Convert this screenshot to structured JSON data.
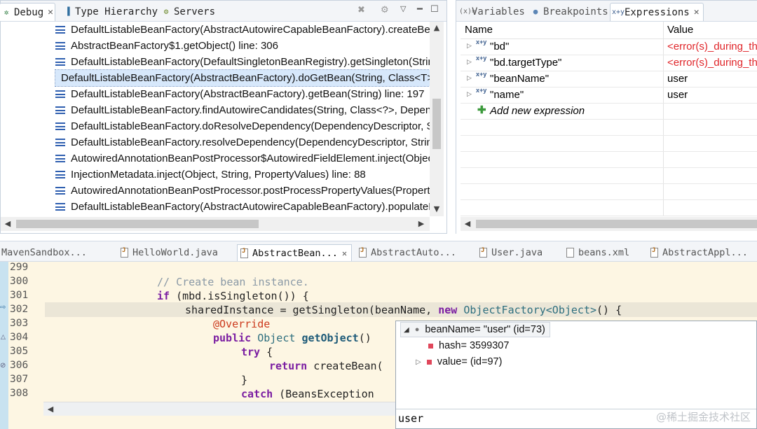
{
  "debug": {
    "tabs": [
      {
        "label": "Debug",
        "icon": "debug-icon"
      },
      {
        "label": "Type Hierarchy",
        "icon": "hierarchy-icon"
      },
      {
        "label": "Servers",
        "icon": "servers-icon"
      }
    ],
    "frames": [
      "DefaultListableBeanFactory(AbstractAutowireCapableBeanFactory).createBea",
      "AbstractBeanFactory$1.getObject() line: 306",
      "DefaultListableBeanFactory(DefaultSingletonBeanRegistry).getSingleton(Strin",
      "DefaultListableBeanFactory(AbstractBeanFactory).doGetBean(String, Class<T>",
      "DefaultListableBeanFactory(AbstractBeanFactory).getBean(String) line: 197",
      "DefaultListableBeanFactory.findAutowireCandidates(String, Class<?>, Depend",
      "DefaultListableBeanFactory.doResolveDependency(DependencyDescriptor, St",
      "DefaultListableBeanFactory.resolveDependency(DependencyDescriptor, String",
      "AutowiredAnnotationBeanPostProcessor$AutowiredFieldElement.inject(Objec",
      "InjectionMetadata.inject(Object, String, PropertyValues) line: 88",
      "AutowiredAnnotationBeanPostProcessor.postProcessPropertyValues(PropertyV",
      "DefaultListableBeanFactory(AbstractAutowireCapableBeanFactory).populateE"
    ],
    "selected_index": 3
  },
  "expressions": {
    "tabs": [
      {
        "label": "Variables",
        "icon": "variables-icon"
      },
      {
        "label": "Breakpoints",
        "icon": "breakpoints-icon"
      },
      {
        "label": "Expressions",
        "icon": "expressions-icon"
      }
    ],
    "col_name": "Name",
    "col_value": "Value",
    "rows": [
      {
        "name": "\"bd\"",
        "value": "<error(s)_during_the"
      },
      {
        "name": "\"bd.targetType\"",
        "value": "<error(s)_during_the"
      },
      {
        "name": "\"beanName\"",
        "value": "user"
      },
      {
        "name": "\"name\"",
        "value": "user"
      }
    ],
    "add_label": "Add new expression"
  },
  "editor": {
    "tabs": [
      "MavenSandbox...",
      "HelloWorld.java",
      "AbstractBean...",
      "AbstractAuto...",
      "User.java",
      "beans.xml",
      "AbstractAppl..."
    ],
    "line_numbers": [
      "299",
      "300",
      "301",
      "302",
      "303",
      "304",
      "305",
      "306",
      "307",
      "308"
    ],
    "code": {
      "l300": "// Create bean instance.",
      "l301_kw": "if",
      "l301_rest": " (mbd.isSingleton()) {",
      "l302_a": "sharedInstance = getSingleton(beanName, ",
      "l302_kw": "new",
      "l302_type": " ObjectFactory<Object>",
      "l302_b": "() {",
      "l303": "@Override",
      "l304_kw": "public",
      "l304_type": " Object ",
      "l304_fn": "getObject",
      "l304_rest": "()",
      "l305_kw": "try",
      "l305_rest": " {",
      "l306_kw": "return",
      "l306_rest": " createBean(",
      "l307": "}",
      "l308_kw": "catch",
      "l308_rest": " (BeansException"
    }
  },
  "hover": {
    "root": "beanName= \"user\" (id=73)",
    "hash": "hash= 3599307",
    "value": "value= (id=97)",
    "detail": "user"
  },
  "watermark": "@稀土掘金技术社区"
}
